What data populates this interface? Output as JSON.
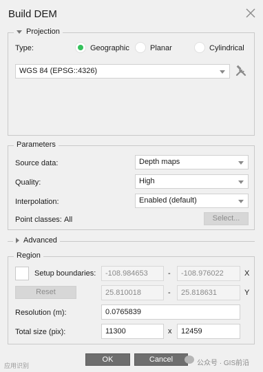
{
  "window": {
    "title": "Build DEM"
  },
  "projection": {
    "legend": "Projection",
    "type_label": "Type:",
    "options": [
      {
        "label": "Geographic",
        "selected": true
      },
      {
        "label": "Planar",
        "selected": false
      },
      {
        "label": "Cylindrical",
        "selected": false
      }
    ],
    "crs_value": "WGS 84 (EPSG::4326)"
  },
  "parameters": {
    "legend": "Parameters",
    "source_label": "Source data:",
    "source_value": "Depth maps",
    "quality_label": "Quality:",
    "quality_value": "High",
    "interp_label": "Interpolation:",
    "interp_value": "Enabled (default)",
    "classes_label": "Point classes:",
    "classes_value": "All",
    "select_button": "Select..."
  },
  "advanced": {
    "legend": "Advanced"
  },
  "region": {
    "legend": "Region",
    "setup_label": "Setup boundaries:",
    "x_min": "-108.984653",
    "x_max": "-108.976022",
    "x_axis": "X",
    "y_min": "25.810018",
    "y_max": "25.818631",
    "y_axis": "Y",
    "dash": "-",
    "reset_button": "Reset",
    "resolution_label": "Resolution (m):",
    "resolution_value": "0.0765839",
    "size_label": "Total size (pix):",
    "size_x": "11300",
    "size_sep": "x",
    "size_y": "12459"
  },
  "footer": {
    "ok": "OK",
    "cancel": "Cancel",
    "watermark_left": "应用识别",
    "watermark_right": "公众号 · GIS前沿"
  },
  "colors": {
    "radio_selected": "#35c15c",
    "button_dark": "#6e6e6e"
  }
}
